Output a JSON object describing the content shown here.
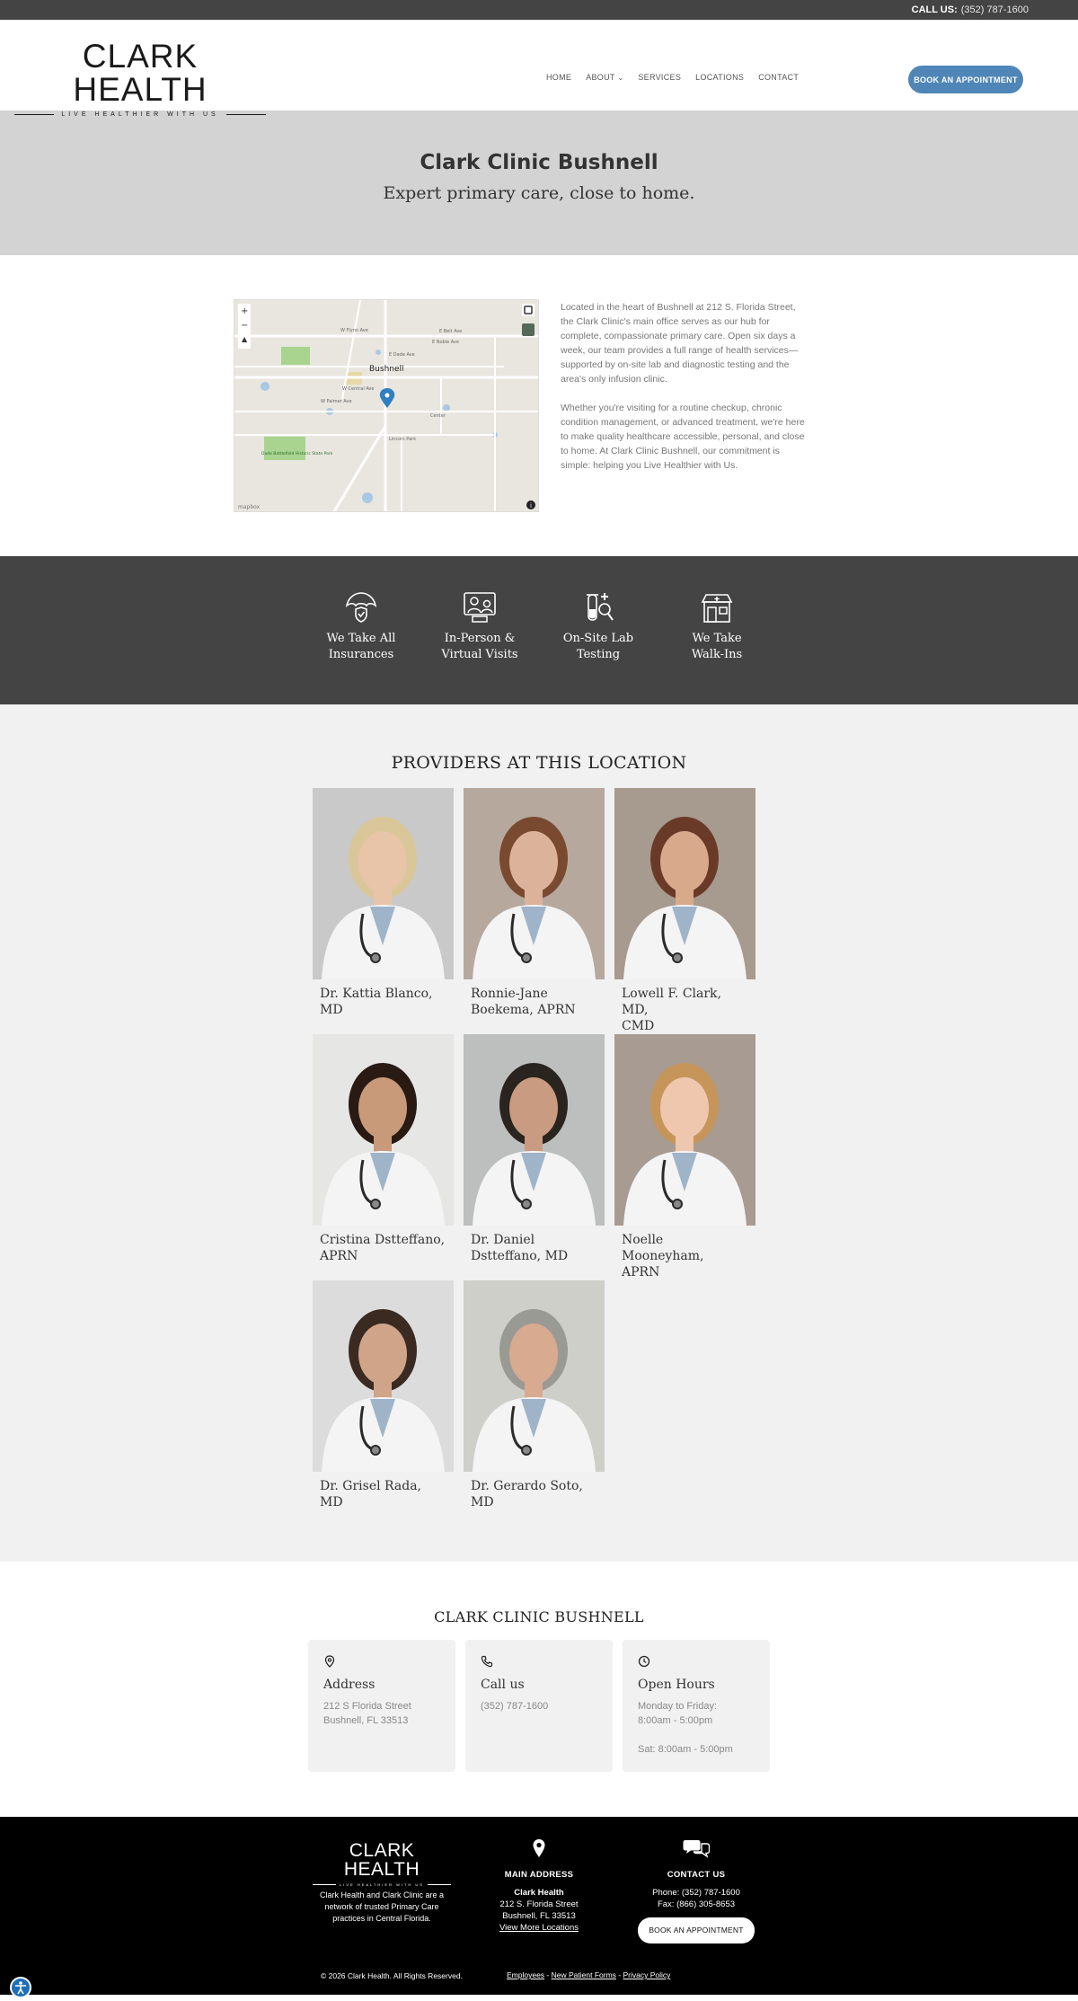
{
  "topbar": {
    "call_label": "CALL US:",
    "phone": "(352) 787-1600"
  },
  "header": {
    "logo_brand": "CLARK HEALTH",
    "logo_tagline": "LIVE HEALTHIER WITH US",
    "nav": [
      "HOME",
      "ABOUT",
      "SERVICES",
      "LOCATIONS",
      "CONTACT"
    ],
    "book_button": "BOOK AN APPOINTMENT"
  },
  "hero": {
    "title": "Clark Clinic Bushnell",
    "subtitle": "Expert primary care, close to home."
  },
  "about": {
    "map": {
      "town_label": "Bushnell",
      "streets": [
        "W Flynn Ave",
        "E Noble Ave",
        "E Dade Ave",
        "E Belt Ave",
        "W Central Ave",
        "W Palmer Ave",
        "Lincoln Park",
        "Center",
        "County Rd 742"
      ],
      "park": "Dade Battlefield Historic State Park",
      "credit": "mapbox"
    },
    "paragraphs": [
      "Located in the heart of Bushnell at 212 S. Florida Street, the Clark Clinic's main office serves as our hub for complete, compassionate primary care. Open six days a week, our team provides a full range of health services—supported by on-site lab and diagnostic testing and the area's only infusion clinic.",
      "Whether you're visiting for a routine checkup, chronic condition management, or advanced treatment, we're here to make quality healthcare accessible, personal, and close to home. At Clark Clinic Bushnell, our commitment is simple: helping you Live Healthier with Us."
    ]
  },
  "features": [
    {
      "icon": "umbrella-shield-icon",
      "line1": "We Take All",
      "line2": "Insurances"
    },
    {
      "icon": "video-visit-icon",
      "line1": "In-Person &",
      "line2": "Virtual Visits"
    },
    {
      "icon": "lab-test-icon",
      "line1": "On-Site Lab",
      "line2": "Testing"
    },
    {
      "icon": "clinic-building-icon",
      "line1": "We Take",
      "line2": "Walk-Ins"
    }
  ],
  "providers": {
    "heading": "PROVIDERS AT THIS LOCATION",
    "list": [
      {
        "line1": "Dr. Kattia Blanco,",
        "line2": "MD",
        "bg": "#c9c9c9",
        "hair": "#d9c79a",
        "skin": "#e8c4a8"
      },
      {
        "line1": "Ronnie-Jane",
        "line2": "Boekema, APRN",
        "bg": "#b7a89e",
        "hair": "#7a4a30",
        "skin": "#dcb39a"
      },
      {
        "line1": "Lowell F. Clark, MD,",
        "line2": "CMD",
        "bg": "#a79a8e",
        "hair": "#6a3a28",
        "skin": "#d9a98c"
      },
      {
        "line1": "Cristina Dstteffano,",
        "line2": "APRN",
        "bg": "#e6e6e4",
        "hair": "#2a1a14",
        "skin": "#c99a7a"
      },
      {
        "line1": "Dr. Daniel",
        "line2": "Dstteffano, MD",
        "bg": "#bdbfbf",
        "hair": "#2a2420",
        "skin": "#c99b80"
      },
      {
        "line1": "Noelle Mooneyham,",
        "line2": "APRN",
        "bg": "#a89b92",
        "hair": "#c6955a",
        "skin": "#efc7ae"
      },
      {
        "line1": "Dr. Grisel Rada, MD",
        "line2": "",
        "bg": "#dcdcdc",
        "hair": "#3a2a22",
        "skin": "#d0a488"
      },
      {
        "line1": "Dr. Gerardo Soto, MD",
        "line2": "",
        "bg": "#cfcfc9",
        "hair": "#9a9a94",
        "skin": "#d8aa90"
      }
    ]
  },
  "location": {
    "heading": "CLARK CLINIC BUSHNELL",
    "address": {
      "title": "Address",
      "line1": "212 S Florida Street",
      "line2": "Bushnell, FL 33513"
    },
    "call": {
      "title": "Call us",
      "phone": "(352) 787-1600"
    },
    "hours": {
      "title": "Open Hours",
      "line1": "Monday to Friday:",
      "line2": "8:00am - 5:00pm",
      "line3": "Sat: 8:00am - 5:00pm"
    }
  },
  "footer": {
    "logo_brand": "CLARK HEALTH",
    "logo_tagline": "LIVE HEALTHIER WITH US",
    "about": "Clark Health and Clark Clinic are a network of trusted Primary Care practices in Central Florida.",
    "main_address": {
      "heading": "MAIN ADDRESS",
      "name": "Clark Health",
      "street": "212 S. Florida Street",
      "city": "Bushnell, FL 33513",
      "link": "View More Locations"
    },
    "contact": {
      "heading": "CONTACT US",
      "phone": "Phone: (352) 787-1600",
      "fax": "Fax: (866) 305-8653",
      "button": "BOOK AN APPOINTMENT"
    },
    "copyright": "© 2026 Clark Health. All Rights Reserved.",
    "links": [
      "Employees",
      "New Patient Forms",
      "Privacy Policy"
    ]
  },
  "colors": {
    "accent": "#4f86b7",
    "dark_band": "#444444",
    "hero_bg": "#d3d3d3",
    "providers_bg": "#f1f1f1",
    "footer_bg": "#000000"
  }
}
